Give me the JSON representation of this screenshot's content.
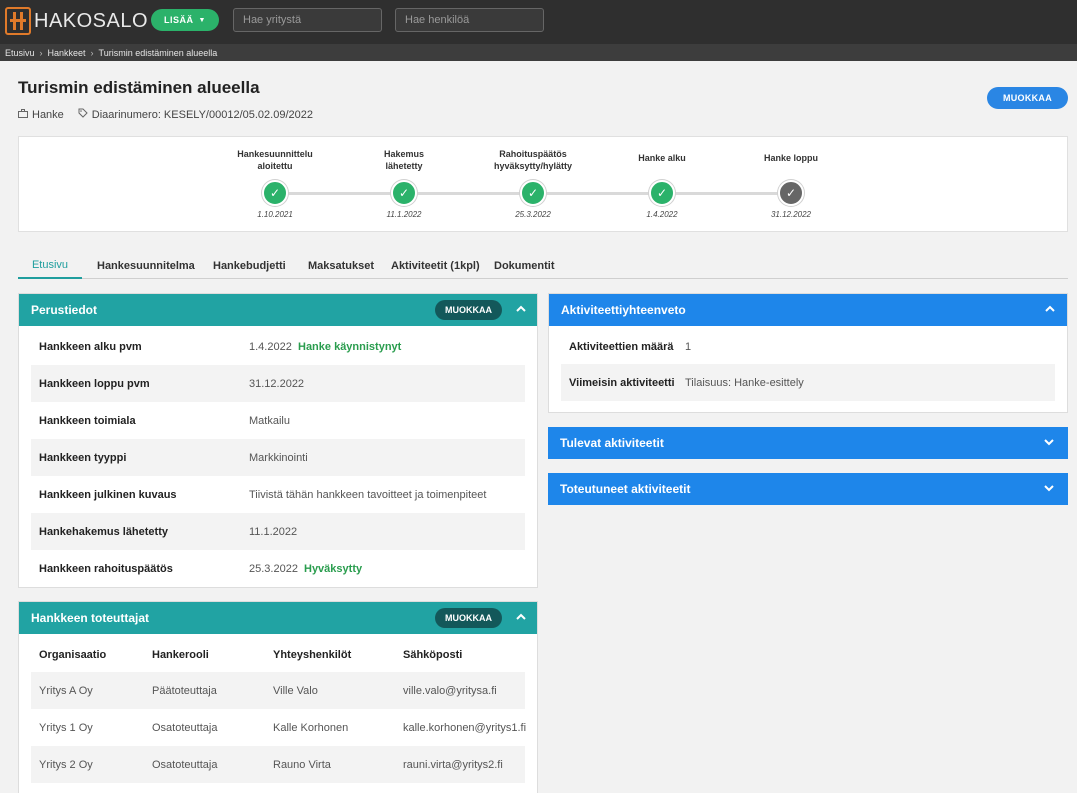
{
  "brand": {
    "name": "HAKOSALO",
    "logo_color": "#e07a2a"
  },
  "topbar": {
    "add_label": "LISÄÄ",
    "company_search_placeholder": "Hae yritystä",
    "person_search_placeholder": "Hae henkilöä"
  },
  "breadcrumb": [
    "Etusivu",
    "Hankkeet",
    "Turismin edistäminen alueella"
  ],
  "header": {
    "title": "Turismin edistäminen alueella",
    "type_label": "Hanke",
    "record_label": "Diaarinumero: KESELY/00012/05.02.09/2022",
    "edit_label": "MUOKKAA"
  },
  "timeline": [
    {
      "label": "Hankesuunnittelu aloitettu",
      "date": "1.10.2021",
      "status": "done"
    },
    {
      "label": "Hakemus lähetetty",
      "date": "11.1.2022",
      "status": "done"
    },
    {
      "label": "Rahoituspäätös hyväksytty/hylätty",
      "date": "25.3.2022",
      "status": "done"
    },
    {
      "label": "Hanke alku",
      "date": "1.4.2022",
      "status": "done"
    },
    {
      "label": "Hanke loppu",
      "date": "31.12.2022",
      "status": "pending"
    }
  ],
  "tabs": [
    "Etusivu",
    "Hankesuunnitelma",
    "Hankebudjetti",
    "Maksatukset",
    "Aktiviteetit (1kpl)",
    "Dokumentit"
  ],
  "basic_info": {
    "title": "Perustiedot",
    "edit_label": "MUOKKAA",
    "rows": [
      {
        "key": "Hankkeen alku pvm",
        "value": "1.4.2022",
        "tag": "Hanke käynnistynyt"
      },
      {
        "key": "Hankkeen loppu pvm",
        "value": "31.12.2022",
        "tag": ""
      },
      {
        "key": "Hankkeen toimiala",
        "value": "Matkailu",
        "tag": ""
      },
      {
        "key": "Hankkeen tyyppi",
        "value": "Markkinointi",
        "tag": ""
      },
      {
        "key": "Hankkeen julkinen kuvaus",
        "value": "Tiivistä tähän hankkeen tavoitteet ja toimenpiteet",
        "tag": ""
      },
      {
        "key": "Hankehakemus lähetetty",
        "value": "11.1.2022",
        "tag": ""
      },
      {
        "key": "Hankkeen rahoituspäätös",
        "value": "25.3.2022",
        "tag": "Hyväksytty"
      }
    ]
  },
  "implementers": {
    "title": "Hankkeen toteuttajat",
    "edit_label": "MUOKKAA",
    "columns": [
      "Organisaatio",
      "Hankerooli",
      "Yhteyshenkilöt",
      "Sähköposti"
    ],
    "rows": [
      [
        "Yritys A Oy",
        "Päätoteuttaja",
        "Ville Valo",
        "ville.valo@yritysa.fi"
      ],
      [
        "Yritys 1 Oy",
        "Osatoteuttaja",
        "Kalle Korhonen",
        "kalle.korhonen@yritys1.fi"
      ],
      [
        "Yritys 2 Oy",
        "Osatoteuttaja",
        "Rauno Virta",
        "rauni.virta@yritys2.fi"
      ]
    ]
  },
  "activity_summary": {
    "title": "Aktiviteettiyhteenveto",
    "rows": [
      {
        "key": "Aktiviteettien määrä",
        "value": "1"
      },
      {
        "key": "Viimeisin aktiviteetti",
        "value": "Tilaisuus: Hanke-esittely"
      }
    ]
  },
  "upcoming": {
    "title": "Tulevat aktiviteetit"
  },
  "completed": {
    "title": "Toteutuneet aktiviteetit"
  },
  "colors": {
    "teal": "#21a3a3",
    "blue": "#1e86ea",
    "green": "#2bb26a",
    "topbar": "#2f2f2f"
  }
}
